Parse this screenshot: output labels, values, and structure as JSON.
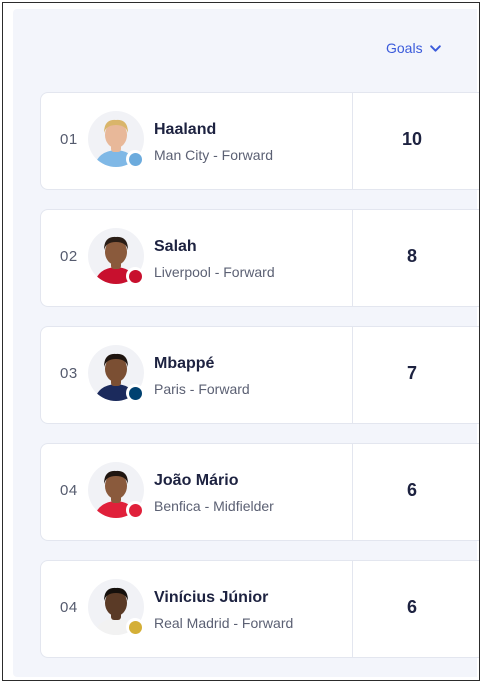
{
  "sort": {
    "label": "Goals"
  },
  "players": [
    {
      "rank": "01",
      "name": "Haaland",
      "subtitle": "Man City - Forward",
      "goals": "10",
      "skin": "#e8b899",
      "hair": "#d9b56a",
      "shirt": "#7fb8e6",
      "badge": "#6cabdd"
    },
    {
      "rank": "02",
      "name": "Salah",
      "subtitle": "Liverpool - Forward",
      "goals": "8",
      "skin": "#8a5a3c",
      "hair": "#2a1d16",
      "shirt": "#c8102e",
      "badge": "#c8102e"
    },
    {
      "rank": "03",
      "name": "Mbappé",
      "subtitle": "Paris - Forward",
      "goals": "7",
      "skin": "#7b4f33",
      "hair": "#1f1510",
      "shirt": "#1b2a5c",
      "badge": "#004170"
    },
    {
      "rank": "04",
      "name": "João Mário",
      "subtitle": "Benfica - Midfielder",
      "goals": "6",
      "skin": "#8a5a3c",
      "hair": "#1f1510",
      "shirt": "#e0203a",
      "badge": "#e0203a"
    },
    {
      "rank": "04",
      "name": "Vinícius Júnior",
      "subtitle": "Real Madrid - Forward",
      "goals": "6",
      "skin": "#5a3a26",
      "hair": "#15100c",
      "shirt": "#f2f2f2",
      "badge": "#d4af37"
    }
  ]
}
